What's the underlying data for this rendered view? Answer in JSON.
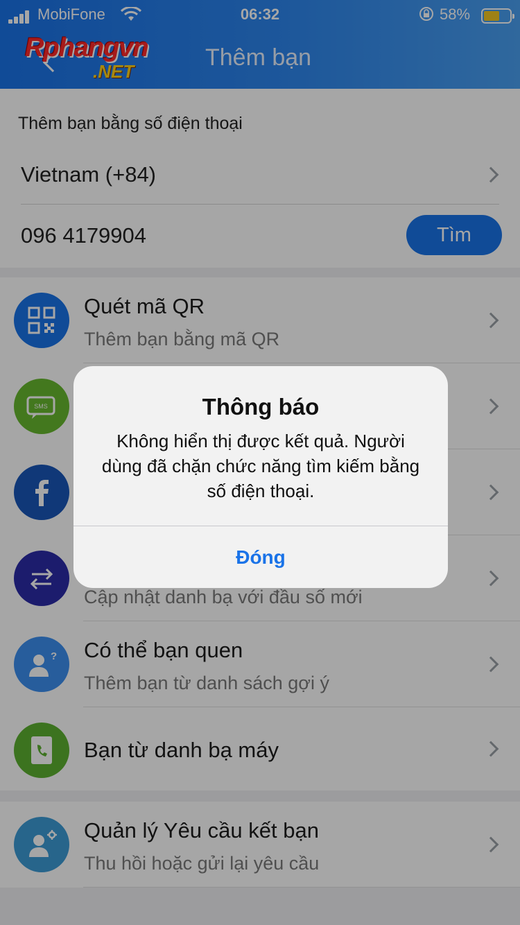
{
  "status_bar": {
    "carrier": "MobiFone",
    "time": "06:32",
    "battery": "58%",
    "battery_level": 0.58
  },
  "header": {
    "logo_line1": "Rphangvn",
    "logo_line2": ".NET",
    "title": "Thêm bạn"
  },
  "phone_search": {
    "section_label": "Thêm bạn bằng số điện thoại",
    "country": "Vietnam (+84)",
    "phone_number": "096 4179904",
    "find_button": "Tìm"
  },
  "menu": {
    "items": [
      {
        "title": "Quét mã QR",
        "subtitle": "Thêm bạn bằng mã QR",
        "icon": "qr-code-icon",
        "color": "#1a73e8"
      },
      {
        "title": "",
        "subtitle": "",
        "icon": "sms-icon",
        "color": "#68b92e"
      },
      {
        "title": "",
        "subtitle": "",
        "icon": "facebook-icon",
        "color": "#1a56b8"
      },
      {
        "title": "",
        "subtitle": "Cập nhật danh bạ với đầu số mới",
        "icon": "swap-arrows-icon",
        "color": "#2c2ca8"
      },
      {
        "title": "Có thể bạn quen",
        "subtitle": "Thêm bạn từ danh sách gợi ý",
        "icon": "person-question-icon",
        "color": "#3d8ff0"
      },
      {
        "title": "Bạn từ danh bạ máy",
        "subtitle": "",
        "icon": "phone-contact-icon",
        "color": "#5cb131"
      }
    ],
    "manage": {
      "title": "Quản lý Yêu cầu kết bạn",
      "subtitle": "Thu hồi hoặc gửi lại yêu cầu",
      "icon": "person-gear-icon",
      "color": "#3d9bd6"
    }
  },
  "dialog": {
    "title": "Thông báo",
    "message": "Không hiển thị được kết quả. Người dùng đã chặn chức năng tìm kiếm bằng số điện thoại.",
    "button": "Đóng"
  }
}
